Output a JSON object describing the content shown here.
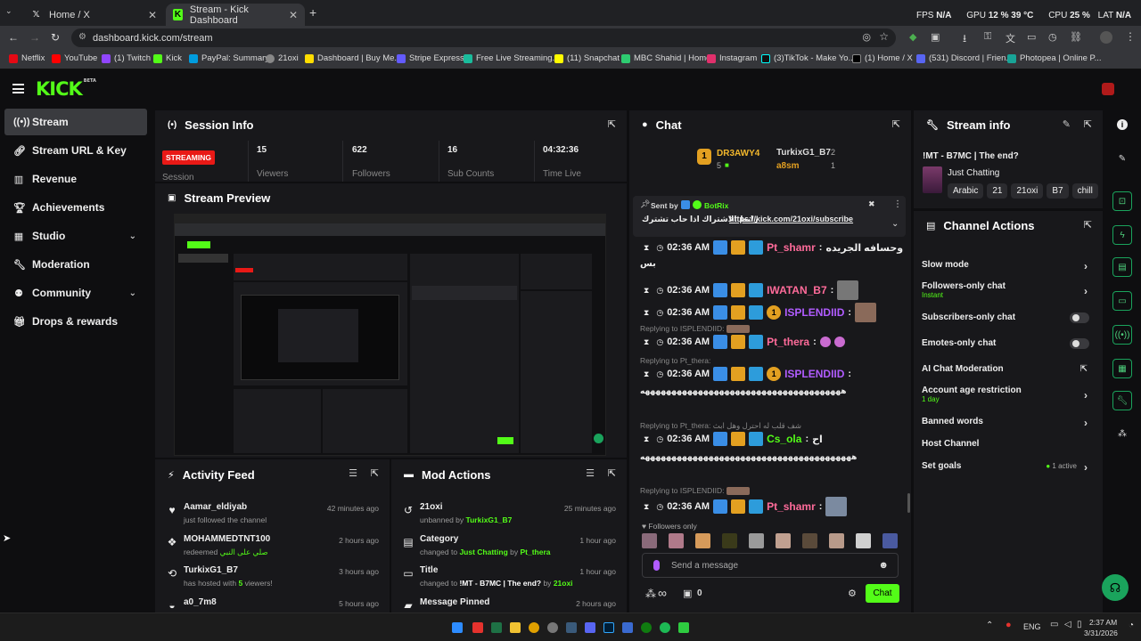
{
  "browser": {
    "tabs": [
      {
        "title": "Home / X",
        "icon": "x-logo-icon"
      },
      {
        "title": "Stream - Kick Dashboard",
        "icon": "kick-logo-icon"
      }
    ],
    "url": "dashboard.kick.com/stream",
    "bookmarks": [
      "Netflix",
      "YouTube",
      "(1) Twitch",
      "Kick",
      "PayPal: Summary",
      "21oxi",
      "Dashboard | Buy Me...",
      "Stripe Express",
      "Free Live Streaming...",
      "(11) Snapchat",
      "MBC Shahid | Home",
      "Instagram",
      "(3)TikTok - Make Yo...",
      "(1) Home / X",
      "(531) Discord | Frien...",
      "Photopea | Online P..."
    ],
    "overlay": {
      "fps_label": "FPS",
      "fps": "N/A",
      "gpu_label": "GPU",
      "gpu": "12 % 39 °C",
      "cpu_label": "CPU",
      "cpu": "25 %",
      "lat_label": "LAT",
      "lat": "N/A"
    }
  },
  "brand": {
    "logo": "KICK",
    "beta": "BETA"
  },
  "sidebar": {
    "items": [
      {
        "label": "Stream",
        "icon": "broadcast-icon"
      },
      {
        "label": "Stream URL & Key",
        "icon": "link-icon"
      },
      {
        "label": "Revenue",
        "icon": "chart-icon"
      },
      {
        "label": "Achievements",
        "icon": "trophy-icon"
      },
      {
        "label": "Studio",
        "icon": "studio-icon"
      },
      {
        "label": "Moderation",
        "icon": "wrench-icon"
      },
      {
        "label": "Community",
        "icon": "community-icon"
      },
      {
        "label": "Drops & rewards",
        "icon": "gift-icon"
      }
    ]
  },
  "session": {
    "title": "Session Info",
    "status": "STREAMING",
    "status_label": "Session",
    "stats": [
      {
        "value": "15",
        "label": "Viewers"
      },
      {
        "value": "622",
        "label": "Followers"
      },
      {
        "value": "16",
        "label": "Sub Counts"
      },
      {
        "value": "04:32:36",
        "label": "Time Live"
      }
    ]
  },
  "preview": {
    "title": "Stream Preview"
  },
  "activity": {
    "title": "Activity Feed",
    "items": [
      {
        "user": "Aamar_eldiyab",
        "detail": "just followed the channel",
        "ago": "42 minutes ago",
        "icon": "heart-icon"
      },
      {
        "user": "MOHAMMEDTNT100",
        "detail_prefix": "redeemed",
        "detail_highlight": "صلي على النبي",
        "ago": "2 hours ago",
        "icon": "reward-icon"
      },
      {
        "user": "TurkixG1_B7",
        "detail_prefix": "has hosted with",
        "detail_highlight": "5",
        "detail_suffix": "viewers!",
        "ago": "3 hours ago",
        "icon": "host-icon"
      },
      {
        "user": "a0_7m8",
        "detail": "",
        "ago": "5 hours ago",
        "icon": "sub-icon"
      }
    ]
  },
  "mod_actions": {
    "title": "Mod Actions",
    "items": [
      {
        "title": "21oxi",
        "detail_prefix": "unbanned by",
        "detail_highlight": "TurkixG1_B7",
        "ago": "25 minutes ago",
        "icon": "undo-icon"
      },
      {
        "title": "Category",
        "detail_prefix": "changed to",
        "detail_highlight": "Just Chatting",
        "detail_mid": "by",
        "detail_highlight2": "Pt_thera",
        "ago": "1 hour ago",
        "icon": "category-icon"
      },
      {
        "title": "Title",
        "detail_prefix": "changed to",
        "detail_highlight": "!MT - B7MC | The end?",
        "detail_mid": "by",
        "detail_highlight2": "21oxi",
        "ago": "1 hour ago",
        "icon": "title-icon"
      },
      {
        "title": "Message Pinned",
        "ago": "2 hours ago",
        "icon": "pin-icon"
      }
    ]
  },
  "chat": {
    "title": "Chat",
    "leaderboard": {
      "first": "DR3AWY4",
      "first_count": "5",
      "second": "TurkixG1_B7",
      "second_count": "2",
      "third": "a8sm",
      "third_count": "1",
      "rank": "1"
    },
    "pinned": {
      "sent_by_label": "Sent by",
      "sender": "BotRix",
      "text": "رابط الاشتراك اذا حاب تشترك",
      "link": "https://kick.com/21oxi/subscribe"
    },
    "messages": [
      {
        "time": "02:36 AM",
        "user": "Pt_shamr",
        "text": "وحسافه الجريده",
        "extra": "بس",
        "color": "#ff6b9a"
      },
      {
        "time": "02:36 AM",
        "user": "IWATAN_B7",
        "text": "",
        "color": "#ff6b9a"
      },
      {
        "time": "02:36 AM",
        "user": "ISPLENDIID",
        "text": "",
        "color": "#b15cff",
        "sub_rank": "1"
      },
      {
        "reply": "Replying to ISPLENDIID:",
        "time": "02:36 AM",
        "user": "Pt_thera",
        "text": "",
        "color": "#ff6b9a"
      },
      {
        "reply": "Replying to Pt_thera:",
        "time": "02:36 AM",
        "user": "ISPLENDIID",
        "text": "ههههههههههههههههههههههههههههههههههههههه",
        "color": "#b15cff",
        "sub_rank": "1"
      },
      {
        "reply": "Replying to Pt_thera: شف قلب له احترل وهل ابث",
        "time": "02:36 AM",
        "user": "Cs_ola",
        "text": "اح",
        "extra": "ههههههههههههههههههههههههههههههههههههههههه",
        "color": "#53fc18"
      },
      {
        "reply": "Replying to ISPLENDIID:",
        "time": "02:36 AM",
        "user": "Pt_shamr",
        "text": "",
        "color": "#ff6b9a"
      }
    ],
    "followers_only": "Followers only",
    "input_placeholder": "Send a message",
    "points": "0",
    "send_label": "Chat"
  },
  "stream_info": {
    "title": "Stream info",
    "stream_title": "!MT - B7MC | The end?",
    "category": "Just Chatting",
    "tags": [
      "Arabic",
      "21",
      "21oxi",
      "B7",
      "chill"
    ]
  },
  "channel_actions": {
    "title": "Channel Actions",
    "items": [
      {
        "label": "Slow mode",
        "kind": "arrow"
      },
      {
        "label": "Followers-only chat",
        "sub": "Instant",
        "kind": "arrow"
      },
      {
        "label": "Subscribers-only chat",
        "kind": "toggle"
      },
      {
        "label": "Emotes-only chat",
        "kind": "toggle"
      },
      {
        "label": "AI Chat Moderation",
        "kind": "external"
      },
      {
        "label": "Account age restriction",
        "sub": "1 day",
        "kind": "arrow"
      },
      {
        "label": "Banned words",
        "kind": "arrow"
      },
      {
        "label": "Host Channel",
        "kind": "none"
      },
      {
        "label": "Set goals",
        "status": "1 active",
        "kind": "arrow"
      }
    ]
  },
  "taskbar": {
    "lang": "ENG",
    "time": "2:37 AM",
    "date": "3/31/2026"
  },
  "colors": {
    "accent": "#53fc18",
    "streaming": "#e91916",
    "panel": "#18181b",
    "bg": "#0e0e10"
  }
}
